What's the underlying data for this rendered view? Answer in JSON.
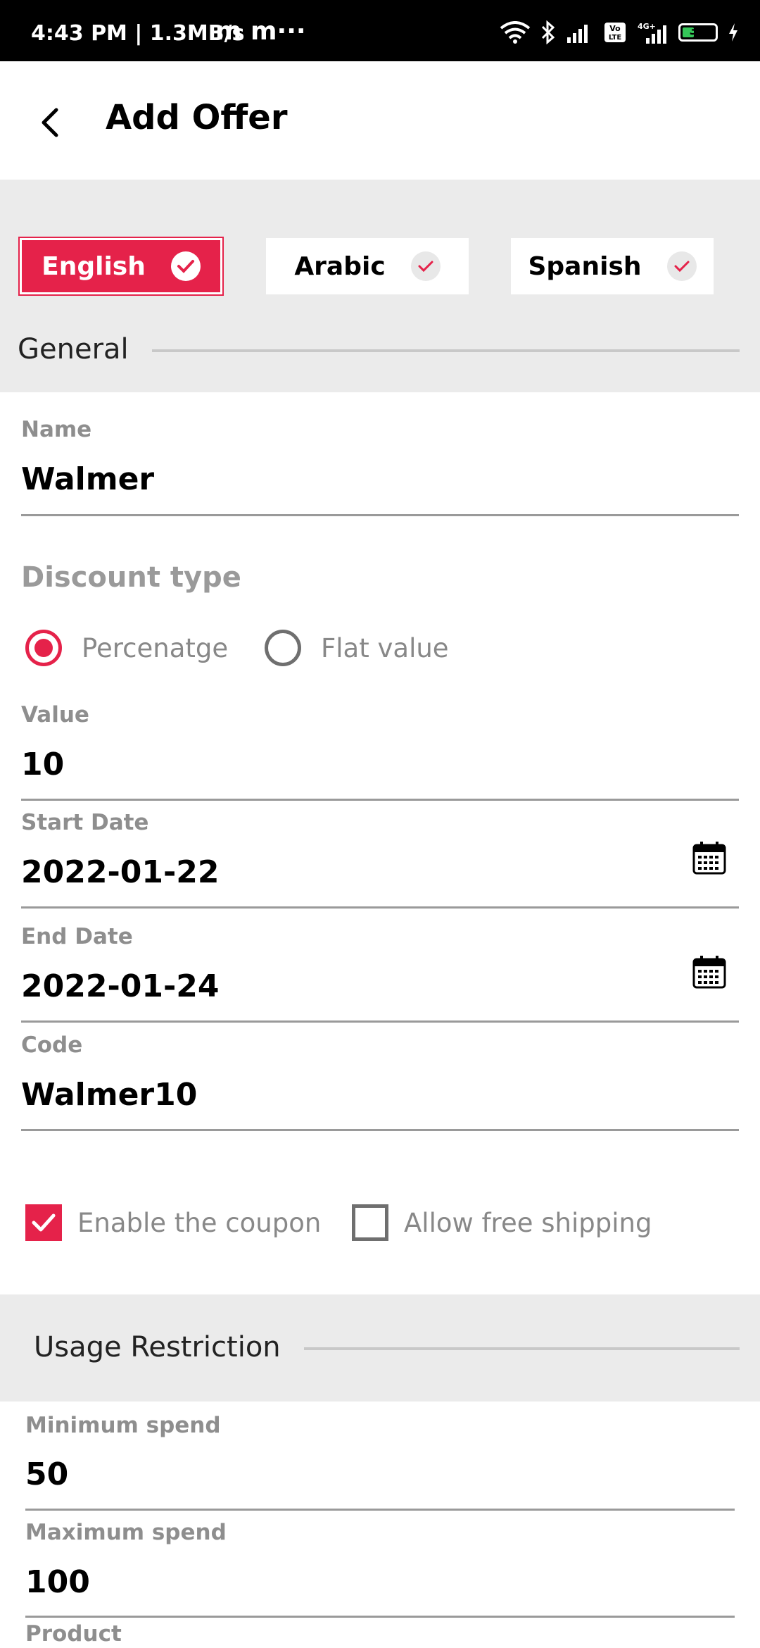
{
  "status_bar": {
    "time": "4:43 PM | 1.3MB/s",
    "carrier_glyphs": "m m···",
    "battery": "32",
    "icons": [
      "wifi-icon",
      "bluetooth-icon",
      "signal-icon",
      "volte-icon",
      "4g-signal-icon",
      "battery-icon",
      "charging-icon"
    ]
  },
  "header": {
    "title": "Add Offer",
    "back_icon": "back-arrow-icon"
  },
  "languages": [
    {
      "label": "English",
      "selected": true
    },
    {
      "label": "Arabic",
      "selected": false
    },
    {
      "label": "Spanish",
      "selected": false
    }
  ],
  "sections": {
    "general": "General",
    "usage": "Usage Restriction"
  },
  "fields": {
    "name": {
      "label": "Name",
      "value": "Walmer"
    },
    "discount_type": {
      "label": "Discount type",
      "options": [
        {
          "label": "Percenatge",
          "selected": true
        },
        {
          "label": "Flat value",
          "selected": false
        }
      ]
    },
    "value": {
      "label": "Value",
      "value": "10"
    },
    "start_date": {
      "label": "Start Date",
      "value": "2022-01-22"
    },
    "end_date": {
      "label": "End Date",
      "value": "2022-01-24"
    },
    "code": {
      "label": "Code",
      "value": "Walmer10"
    },
    "enable_coupon": {
      "label": "Enable the coupon",
      "checked": true
    },
    "free_shipping": {
      "label": "Allow free shipping",
      "checked": false
    },
    "minimum_spend": {
      "label": "Minimum spend",
      "value": "50"
    },
    "maximum_spend": {
      "label": "Maximum spend",
      "value": "100"
    },
    "product": {
      "label": "Product"
    }
  },
  "colors": {
    "accent": "#e5224a",
    "band": "#ebebeb",
    "muted_text": "#8e8e8e"
  }
}
